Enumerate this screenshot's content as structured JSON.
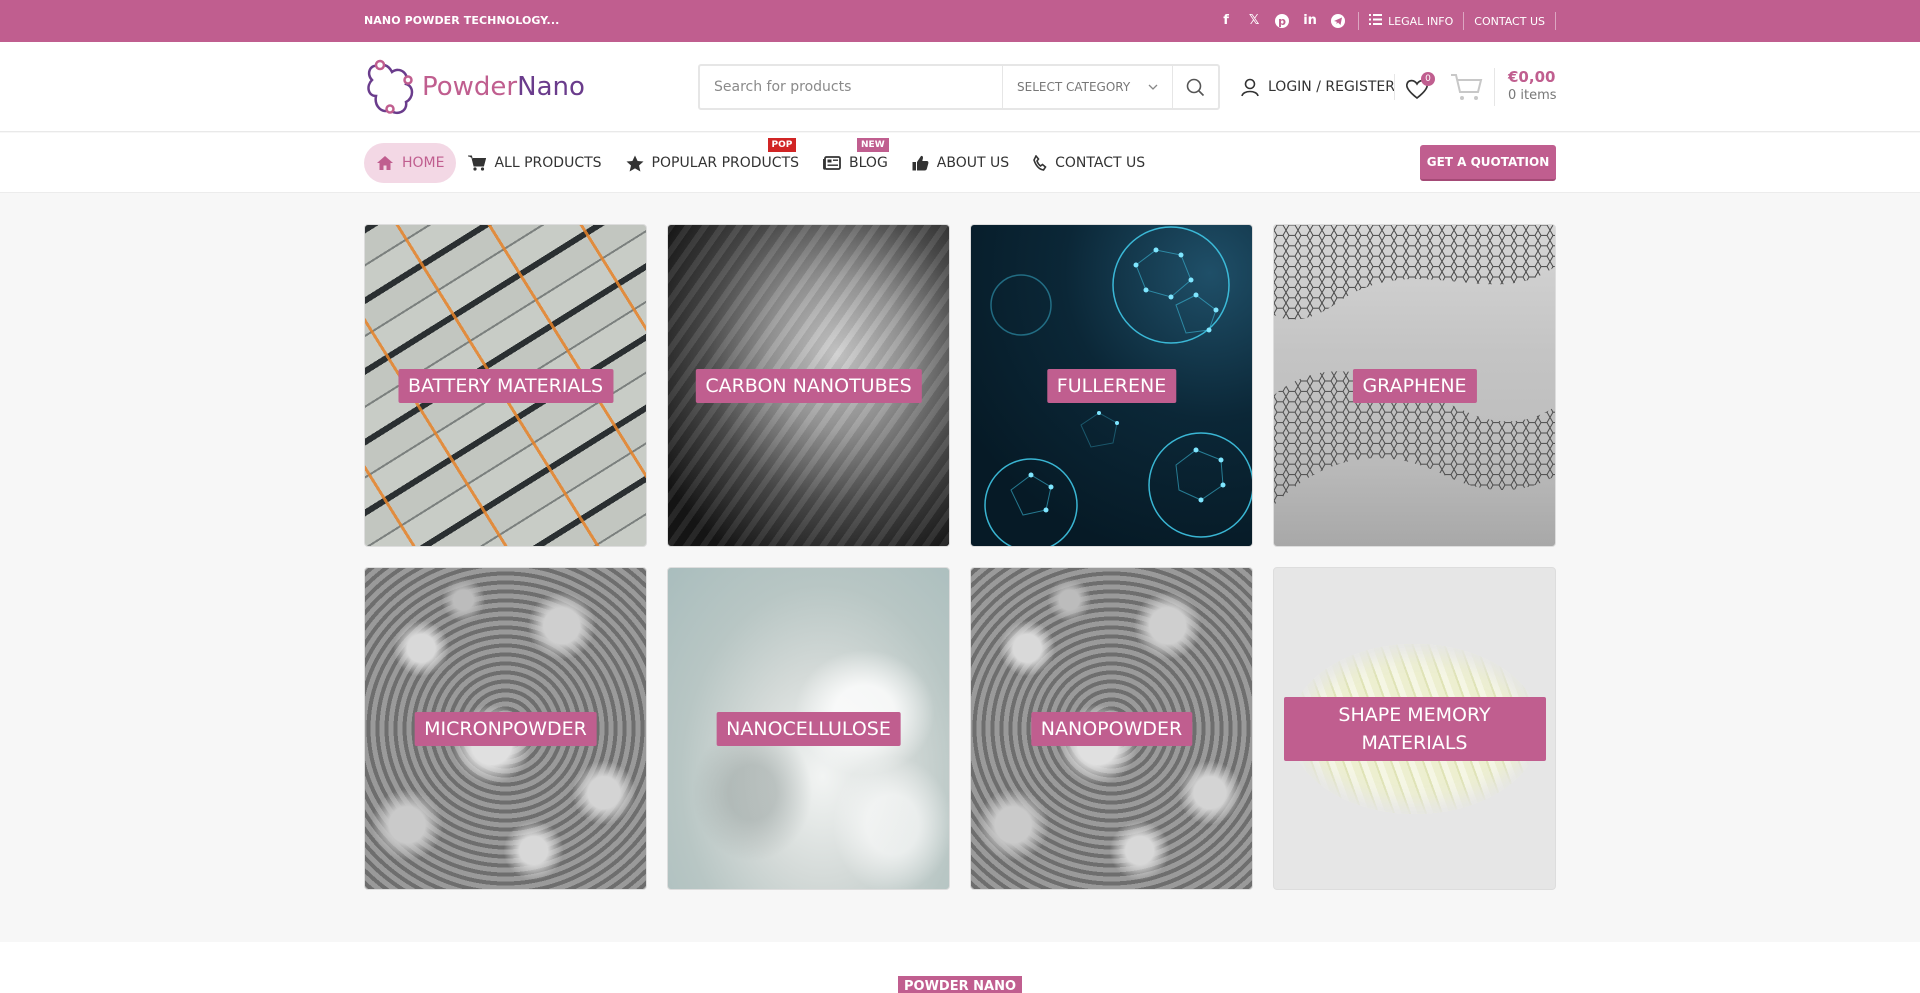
{
  "topbar": {
    "tagline": "NANO POWDER TECHNOLOGY...",
    "social": [
      "facebook-icon",
      "x-icon",
      "pinterest-icon",
      "linkedin-icon",
      "telegram-icon"
    ],
    "legal_label": "LEGAL INFO",
    "contact_label": "CONTACT US"
  },
  "header": {
    "logo_part1": "Powder",
    "logo_part2": "Nano",
    "search_placeholder": "Search for products",
    "category_label": "SELECT CATEGORY",
    "login_label": "LOGIN / REGISTER",
    "wishlist_count": "0",
    "cart_count": "0",
    "cart_amount": "€0,00",
    "cart_items": "0 items"
  },
  "nav": {
    "items": [
      {
        "label": "HOME",
        "icon": "home-icon"
      },
      {
        "label": "ALL PRODUCTS",
        "icon": "cart-icon"
      },
      {
        "label": "POPULAR PRODUCTS",
        "icon": "star-icon",
        "badge": "POP"
      },
      {
        "label": "BLOG",
        "icon": "newspaper-icon",
        "badge": "NEW"
      },
      {
        "label": "ABOUT US",
        "icon": "thumbs-up-icon"
      },
      {
        "label": "CONTACT US",
        "icon": "phone-icon"
      }
    ],
    "quote_label": "GET A QUOTATION"
  },
  "categories": [
    {
      "label": "BATTERY MATERIALS"
    },
    {
      "label": "CARBON NANOTUBES"
    },
    {
      "label": "FULLERENE"
    },
    {
      "label": "GRAPHENE"
    },
    {
      "label": "MICRONPOWDER"
    },
    {
      "label": "NANOCELLULOSE"
    },
    {
      "label": "NANOPOWDER"
    },
    {
      "label": "SHAPE MEMORY MATERIALS"
    }
  ],
  "section": {
    "badge": "POWDER NANO"
  },
  "colors": {
    "brand": "#c05e8f",
    "brand_dark": "#6a3c8c",
    "pop_badge": "#d12525"
  }
}
